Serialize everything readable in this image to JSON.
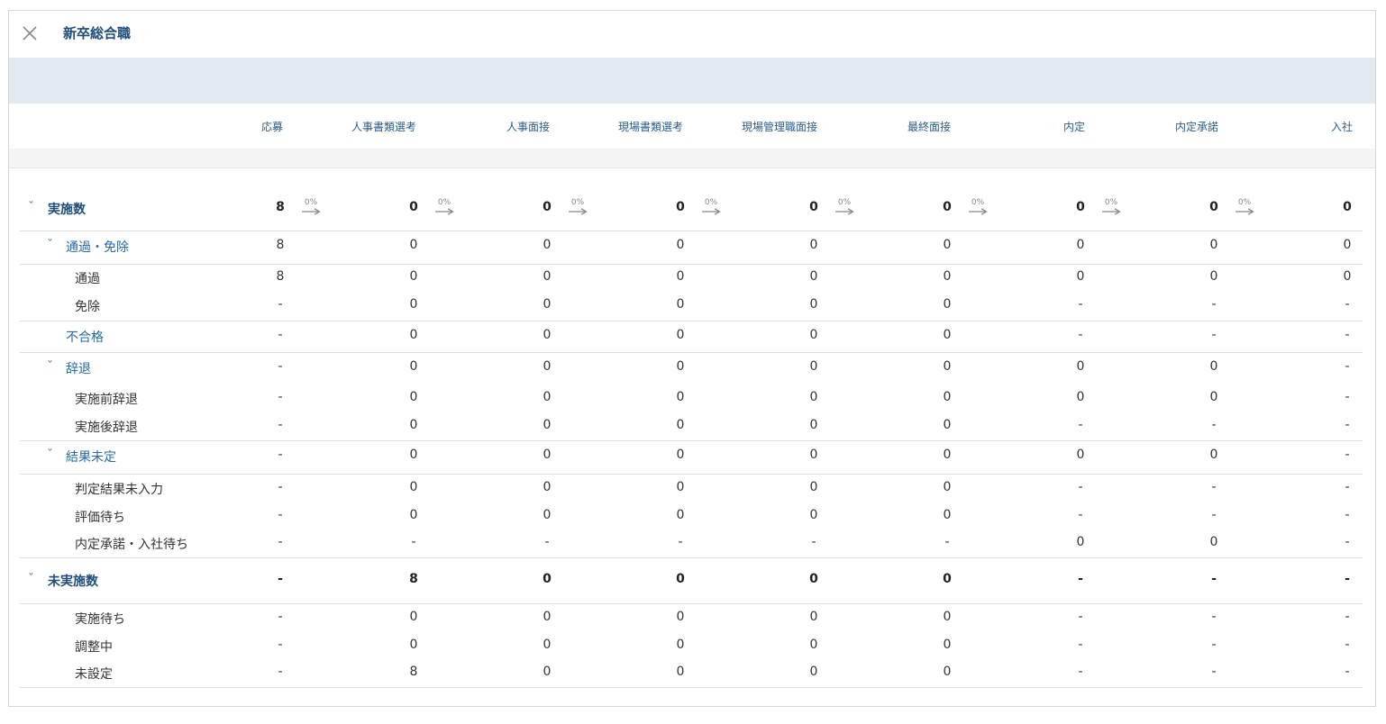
{
  "header": {
    "title": "新卒総合職",
    "close_icon": "close-icon"
  },
  "columns": [
    "応募",
    "人事書類選考",
    "人事面接",
    "現場書類選考",
    "現場管理職面接",
    "最終面接",
    "内定",
    "内定承諾",
    "入社"
  ],
  "rows": [
    {
      "level": 1,
      "expand": true,
      "label": "実施数",
      "values": [
        "8",
        "0",
        "0",
        "0",
        "0",
        "0",
        "0",
        "0",
        "0"
      ],
      "rates": [
        "0%",
        "0%",
        "0%",
        "0%",
        "0%",
        "0%",
        "0%",
        "0%"
      ]
    },
    {
      "level": 2,
      "expand": true,
      "label": "通過・免除",
      "values": [
        "8",
        "0",
        "0",
        "0",
        "0",
        "0",
        "0",
        "0",
        "0"
      ]
    },
    {
      "level": 3,
      "label": "通過",
      "values": [
        "8",
        "0",
        "0",
        "0",
        "0",
        "0",
        "0",
        "0",
        "0"
      ]
    },
    {
      "level": 3,
      "label": "免除",
      "values": [
        "-",
        "0",
        "0",
        "0",
        "0",
        "0",
        "-",
        "-",
        "-"
      ]
    },
    {
      "level": 2,
      "expand": false,
      "label": "不合格",
      "values": [
        "-",
        "0",
        "0",
        "0",
        "0",
        "0",
        "-",
        "-",
        "-"
      ]
    },
    {
      "level": 2,
      "expand": true,
      "label": "辞退",
      "values": [
        "-",
        "0",
        "0",
        "0",
        "0",
        "0",
        "0",
        "0",
        "-"
      ]
    },
    {
      "level": 3,
      "label": "実施前辞退",
      "values": [
        "-",
        "0",
        "0",
        "0",
        "0",
        "0",
        "0",
        "0",
        "-"
      ]
    },
    {
      "level": 3,
      "label": "実施後辞退",
      "values": [
        "-",
        "0",
        "0",
        "0",
        "0",
        "0",
        "-",
        "-",
        "-"
      ]
    },
    {
      "level": 2,
      "expand": true,
      "label": "結果未定",
      "values": [
        "-",
        "0",
        "0",
        "0",
        "0",
        "0",
        "0",
        "0",
        "-"
      ]
    },
    {
      "level": 3,
      "label": "判定結果未入力",
      "values": [
        "-",
        "0",
        "0",
        "0",
        "0",
        "0",
        "-",
        "-",
        "-"
      ]
    },
    {
      "level": 3,
      "label": "評価待ち",
      "values": [
        "-",
        "0",
        "0",
        "0",
        "0",
        "0",
        "-",
        "-",
        "-"
      ]
    },
    {
      "level": 3,
      "label": "内定承諾・入社待ち",
      "values": [
        "-",
        "-",
        "-",
        "-",
        "-",
        "-",
        "0",
        "0",
        "-"
      ]
    },
    {
      "level": 1,
      "expand": true,
      "label": "未実施数",
      "values": [
        "-",
        "8",
        "0",
        "0",
        "0",
        "0",
        "-",
        "-",
        "-"
      ]
    },
    {
      "level": 3,
      "label": "実施待ち",
      "values": [
        "-",
        "0",
        "0",
        "0",
        "0",
        "0",
        "-",
        "-",
        "-"
      ]
    },
    {
      "level": 3,
      "label": "調整中",
      "values": [
        "-",
        "0",
        "0",
        "0",
        "0",
        "0",
        "-",
        "-",
        "-"
      ]
    },
    {
      "level": 3,
      "label": "未設定",
      "values": [
        "-",
        "8",
        "0",
        "0",
        "0",
        "0",
        "-",
        "-",
        "-"
      ]
    }
  ],
  "colors": {
    "accent": "#1f4d78",
    "link": "#2b6aa0",
    "band": "#e3eaef"
  }
}
